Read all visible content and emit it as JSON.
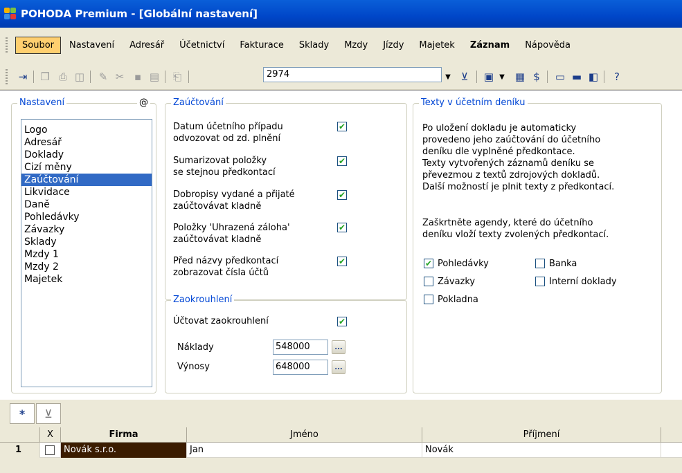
{
  "window": {
    "title": "POHODA Premium - [Globální nastavení]"
  },
  "menu": {
    "items": [
      {
        "label": "Soubor"
      },
      {
        "label": "Nastavení"
      },
      {
        "label": "Adresář"
      },
      {
        "label": "Účetnictví"
      },
      {
        "label": "Fakturace"
      },
      {
        "label": "Sklady"
      },
      {
        "label": "Mzdy"
      },
      {
        "label": "Jízdy"
      },
      {
        "label": "Majetek"
      },
      {
        "label": "Záznam"
      },
      {
        "label": "Nápověda"
      }
    ]
  },
  "toolbar": {
    "record_value": "2974"
  },
  "settings_panel": {
    "title": "Nastavení",
    "at_symbol": "@",
    "items": [
      "Logo",
      "Adresář",
      "Doklady",
      "Cizí měny",
      "Zaúčtování",
      "Likvidace",
      "Daně",
      "Pohledávky",
      "Závazky",
      "Sklady",
      "Mzdy 1",
      "Mzdy 2",
      "Majetek"
    ],
    "selected": "Zaúčtování"
  },
  "zauctovani": {
    "title": "Zaúčtování",
    "options": [
      {
        "line1": "Datum účetního případu",
        "line2": "odvozovat od zd. plnění",
        "checked": true
      },
      {
        "line1": "Sumarizovat položky",
        "line2": "se stejnou předkontací",
        "checked": true
      },
      {
        "line1": "Dobropisy vydané a přijaté",
        "line2": "zaúčtovávat kladně",
        "checked": true
      },
      {
        "line1": "Položky 'Uhrazená záloha'",
        "line2": "zaúčtovávat kladně",
        "checked": true
      },
      {
        "line1": "Před názvy předkontací",
        "line2": "zobrazovat čísla účtů",
        "checked": true
      }
    ]
  },
  "zaokrouhleni": {
    "title": "Zaokrouhlení",
    "uctovat_label": "Účtovat zaokrouhlení",
    "uctovat_checked": true,
    "naklady_label": "Náklady",
    "naklady_value": "548000",
    "vynosy_label": "Výnosy",
    "vynosy_value": "648000",
    "dots": "..."
  },
  "texty": {
    "title": "Texty v účetním deníku",
    "paragraph1": [
      "Po uložení dokladu je automaticky",
      "provedeno jeho zaúčtování do účetního",
      "deníku dle vyplněné předkontace.",
      "Texty vytvořených záznamů deníku se",
      "převezmou z textů zdrojových dokladů.",
      "Další možností je plnit texty z předkontací."
    ],
    "paragraph2": [
      "Zaškrtněte agendy, které do účetního",
      "deníku vloží texty zvolených předkontací."
    ],
    "agendas": [
      {
        "label": "Pohledávky",
        "checked": true
      },
      {
        "label": "Závazky",
        "checked": false
      },
      {
        "label": "Pokladna",
        "checked": false
      },
      {
        "label": "Banka",
        "checked": false
      },
      {
        "label": "Interní doklady",
        "checked": false
      }
    ]
  },
  "grid": {
    "tab_star": "*",
    "columns": [
      "X",
      "Firma",
      "Jméno",
      "Příjmení"
    ],
    "rows": [
      {
        "num": "1",
        "firma": "Novák s.r.o.",
        "jmeno": "Jan",
        "prijmeni": "Novák"
      }
    ]
  },
  "colors": {
    "title_bar": "#0046c8",
    "accent_blue": "#0046d5",
    "selection": "#316ac5",
    "menu_active": "#ffcf6f",
    "check_green": "#21a121"
  }
}
